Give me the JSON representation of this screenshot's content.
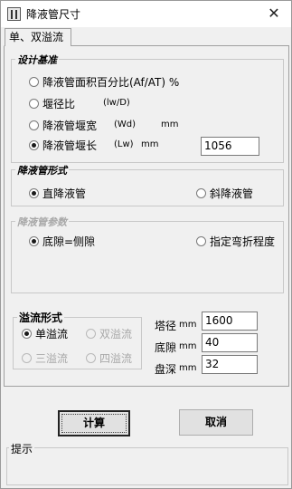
{
  "window": {
    "title": "降液管尺寸",
    "close_glyph": "✕"
  },
  "tabs": [
    {
      "label": "单、双溢流"
    }
  ],
  "design_basis": {
    "title": "设计基准",
    "options": [
      {
        "label": "降液管面积百分比(Af/AT) %",
        "checked": false
      },
      {
        "label": "堰径比",
        "unit": "(lw/D)",
        "checked": false
      },
      {
        "label": "降液管堰宽",
        "unit": "(Wd)",
        "unit2": "mm",
        "checked": false
      },
      {
        "label": "降液管堰长",
        "unit": "(Lw)",
        "unit2": "mm",
        "checked": true
      }
    ],
    "value": "1056"
  },
  "downcomer_form": {
    "title": "降液管形式",
    "straight_label": "直降液管",
    "inclined_label": "斜降液管",
    "selected": "straight"
  },
  "downcomer_params": {
    "title": "降液管参数",
    "bottom_gap_label": "底隙=侧隙",
    "bend_label": "指定弯折程度",
    "selected": "bottom_gap"
  },
  "overflow_form": {
    "title": "溢流形式",
    "options": [
      {
        "label": "单溢流",
        "checked": true,
        "enabled": true
      },
      {
        "label": "双溢流",
        "checked": false,
        "enabled": false
      },
      {
        "label": "三溢流",
        "checked": false,
        "enabled": false
      },
      {
        "label": "四溢流",
        "checked": false,
        "enabled": false
      }
    ]
  },
  "dimensions": {
    "diameter_label": "塔径",
    "diameter_unit": "mm",
    "diameter_value": "1600",
    "gap_label": "底隙",
    "gap_unit": "mm",
    "gap_value": "40",
    "depth_label": "盘深",
    "depth_unit": "mm",
    "depth_value": "32"
  },
  "buttons": {
    "calculate": "计算",
    "cancel": "取消"
  },
  "hint": {
    "title": "提示",
    "text": ""
  }
}
